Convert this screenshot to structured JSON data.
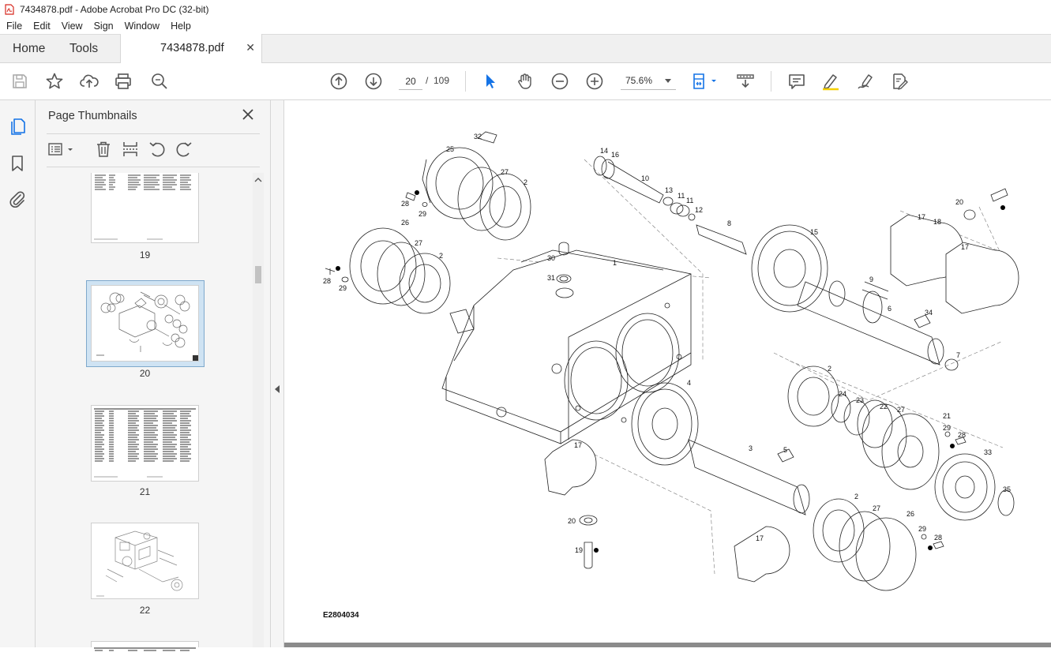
{
  "window": {
    "title": "7434878.pdf - Adobe Acrobat Pro DC (32-bit)"
  },
  "menu": [
    "File",
    "Edit",
    "View",
    "Sign",
    "Window",
    "Help"
  ],
  "tabs": {
    "home": "Home",
    "tools": "Tools",
    "document": "7434878.pdf"
  },
  "toolbar": {
    "current_page": "20",
    "page_separator": "/",
    "total_pages": "109",
    "zoom": "75.6%"
  },
  "panel": {
    "title": "Page Thumbnails",
    "thumbnails": [
      {
        "label": "19",
        "kind": "text-table"
      },
      {
        "label": "20",
        "kind": "exploded-drawing",
        "selected": true
      },
      {
        "label": "21",
        "kind": "text-table"
      },
      {
        "label": "22",
        "kind": "engine-drawing"
      }
    ]
  },
  "document": {
    "drawing_code": "E2804034",
    "callouts": [
      "1",
      "2",
      "3",
      "4",
      "5",
      "6",
      "7",
      "8",
      "9",
      "10",
      "11",
      "12",
      "13",
      "14",
      "15",
      "16",
      "17",
      "18",
      "19",
      "20",
      "21",
      "22",
      "23",
      "24",
      "25",
      "26",
      "27",
      "28",
      "29",
      "30",
      "31",
      "32",
      "33",
      "34",
      "35"
    ]
  },
  "colors": {
    "accent": "#1473e6",
    "selected_thumb_bg": "#cfe3f3",
    "acrobat_red": "#d7281e"
  }
}
